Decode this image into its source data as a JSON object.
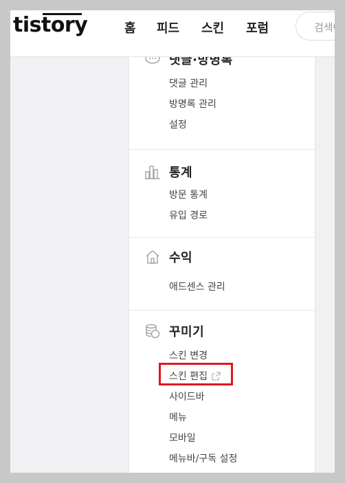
{
  "header": {
    "logo": "tistory",
    "nav": [
      "홈",
      "피드",
      "스킨",
      "포럼"
    ],
    "search_placeholder": "검색어"
  },
  "sidebar": {
    "sections": [
      {
        "title": "댓글·방명록",
        "icon": "speech-bubble-icon",
        "items": [
          "댓글 관리",
          "방명록 관리",
          "설정"
        ]
      },
      {
        "title": "통계",
        "icon": "bar-chart-icon",
        "items": [
          "방문 통계",
          "유입 경로"
        ]
      },
      {
        "title": "수익",
        "icon": "home-icon",
        "items": [
          "애드센스 관리"
        ]
      },
      {
        "title": "꾸미기",
        "icon": "coins-icon",
        "items": [
          "스킨 변경",
          "스킨 편집",
          "사이드바",
          "메뉴",
          "모바일",
          "메뉴바/구독 설정"
        ]
      }
    ]
  },
  "colors": {
    "highlight": "#e3141e"
  }
}
